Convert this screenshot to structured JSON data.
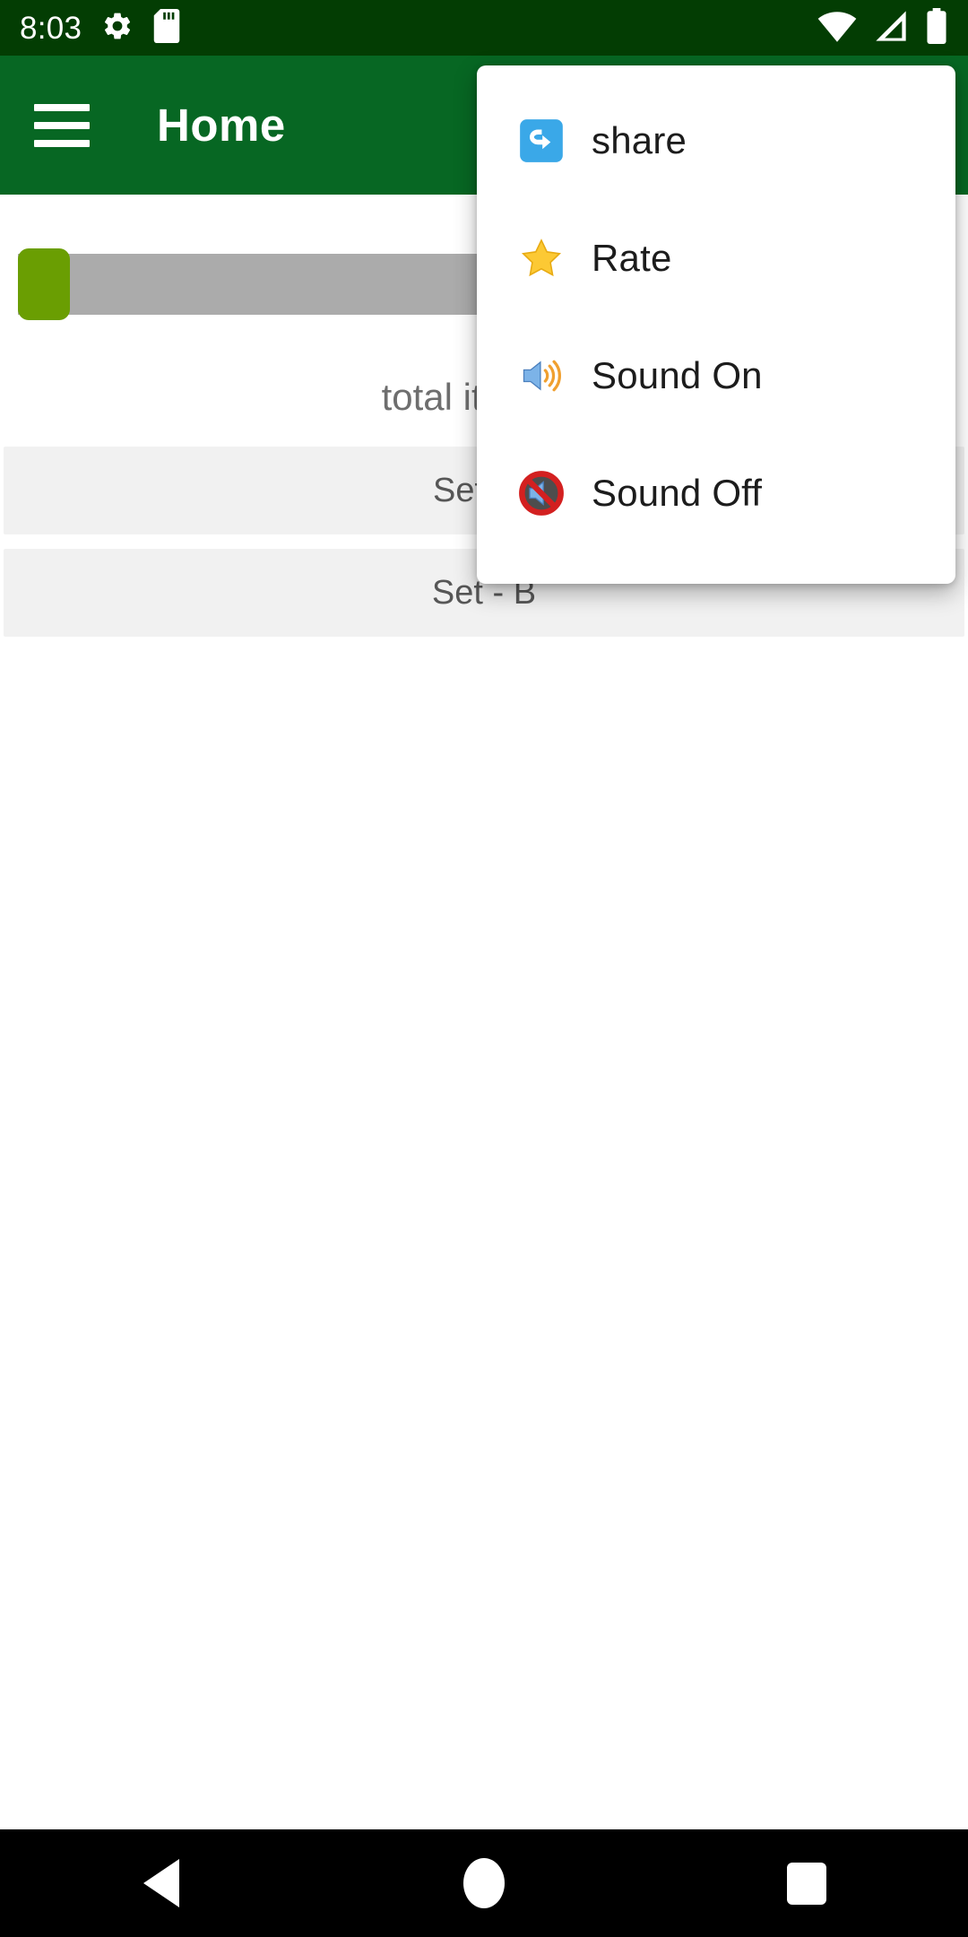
{
  "status_bar": {
    "clock": "8:03",
    "left_icons": [
      "gear-icon",
      "sd-card-icon"
    ],
    "right_icons": [
      "wifi-icon",
      "cellular-signal-icon",
      "battery-full-icon"
    ],
    "background_color": "#033d03",
    "foreground_color": "#ffffff"
  },
  "app_bar": {
    "title": "Home",
    "menu_icon": "hamburger-menu-icon",
    "background_color": "#076723",
    "title_color": "#ffffff"
  },
  "content": {
    "progress": {
      "value_percent": 4,
      "fill_color": "#6a9e02",
      "track_color": "#ababab"
    },
    "caption": "total item qu",
    "caption_color": "#6e6e6e",
    "sets": [
      {
        "label": "Set - A"
      },
      {
        "label": "Set - B"
      }
    ]
  },
  "popup_menu": {
    "background_color": "#ffffff",
    "items": [
      {
        "label": "share",
        "icon": "share-arrow-icon"
      },
      {
        "label": "Rate",
        "icon": "star-icon"
      },
      {
        "label": "Sound On",
        "icon": "speaker-on-icon"
      },
      {
        "label": "Sound Off",
        "icon": "speaker-muted-icon"
      }
    ]
  },
  "nav_bar": {
    "background_color": "#000000",
    "buttons": [
      {
        "name": "back",
        "icon": "triangle-back-icon"
      },
      {
        "name": "home",
        "icon": "circle-home-icon"
      },
      {
        "name": "recents",
        "icon": "square-recents-icon"
      }
    ]
  }
}
